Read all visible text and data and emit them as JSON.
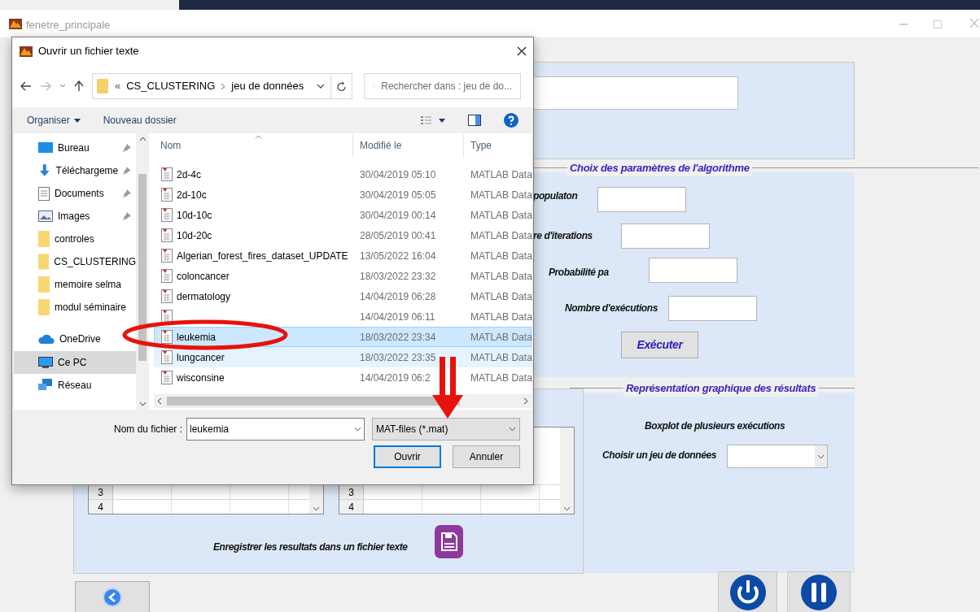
{
  "main_window": {
    "title": "fenetre_principale"
  },
  "parameters_panel": {
    "title": "Choix des paramètres de l'algorithme",
    "fields": [
      {
        "label": "populaton"
      },
      {
        "label": "re d'iterations"
      },
      {
        "label": "Probabilité pa"
      },
      {
        "label": "Nombre d'exécutions"
      }
    ],
    "run_button": "Exécuter"
  },
  "results_panel": {
    "tables": [
      {
        "rows": [
          "3",
          "4"
        ]
      },
      {
        "rows": [
          "3",
          "4"
        ]
      }
    ],
    "save_label": "Enregistrer les resultats dans un fichier texte"
  },
  "graph_panel": {
    "title": "Représentation graphique des résultats",
    "subtitle": "Boxplot de plusieurs exécutions",
    "dataset_label": "Choisir un jeu de données"
  },
  "dialog": {
    "title": "Ouvrir un fichier texte",
    "breadcrumb": [
      "CS_CLUSTERING",
      "jeu de données"
    ],
    "breadcrumb_prefix": "«",
    "search_placeholder": "Rechercher dans : jeu de do...",
    "toolbar": [
      "Organiser",
      "Nouveau dossier"
    ],
    "sidebar": [
      {
        "label": "Bureau",
        "kind": "desktop",
        "pinned": true,
        "selected": false
      },
      {
        "label": "Téléchargeme",
        "kind": "download",
        "pinned": true,
        "selected": false
      },
      {
        "label": "Documents",
        "kind": "document",
        "pinned": true,
        "selected": false
      },
      {
        "label": "Images",
        "kind": "image",
        "pinned": true,
        "selected": false
      },
      {
        "label": "controles",
        "kind": "folder",
        "pinned": false,
        "selected": false
      },
      {
        "label": "CS_CLUSTERING",
        "kind": "folder",
        "pinned": false,
        "selected": false
      },
      {
        "label": "memoire selma",
        "kind": "folder",
        "pinned": false,
        "selected": false
      },
      {
        "label": "modul séminaire",
        "kind": "folder",
        "pinned": false,
        "selected": false
      },
      {
        "label": "OneDrive",
        "kind": "cloud",
        "pinned": false,
        "selected": false
      },
      {
        "label": "Ce PC",
        "kind": "pc",
        "pinned": false,
        "selected": true
      },
      {
        "label": "Réseau",
        "kind": "network",
        "pinned": false,
        "selected": false
      }
    ],
    "columns": [
      "Nom",
      "Modifié le",
      "Type"
    ],
    "files": [
      {
        "name": "2d-4c",
        "modified": "30/04/2019 05:10",
        "type": "MATLAB Data",
        "selected": false,
        "hovered": false
      },
      {
        "name": "2d-10c",
        "modified": "30/04/2019 05:05",
        "type": "MATLAB Data",
        "selected": false,
        "hovered": false
      },
      {
        "name": "10d-10c",
        "modified": "30/04/2019 00:14",
        "type": "MATLAB Data",
        "selected": false,
        "hovered": false
      },
      {
        "name": "10d-20c",
        "modified": "28/05/2019 00:41",
        "type": "MATLAB Data",
        "selected": false,
        "hovered": false
      },
      {
        "name": "Algerian_forest_fires_dataset_UPDATE",
        "modified": "13/05/2022 16:04",
        "type": "MATLAB Data",
        "selected": false,
        "hovered": false
      },
      {
        "name": "coloncancer",
        "modified": "18/03/2022 23:32",
        "type": "MATLAB Data",
        "selected": false,
        "hovered": false
      },
      {
        "name": "dermatology",
        "modified": "14/04/2019 06:28",
        "type": "MATLAB Data",
        "selected": false,
        "hovered": false
      },
      {
        "modified": "14/04/2019 06:11",
        "type": "MATLAB Data",
        "selected": false,
        "hovered": false
      },
      {
        "name": "leukemia",
        "modified": "18/03/2022 23:34",
        "type": "MATLAB Data",
        "selected": true,
        "hovered": false
      },
      {
        "name": "lungcancer",
        "modified": "18/03/2022 23:35",
        "type": "MATLAB Data",
        "selected": false,
        "hovered": true
      },
      {
        "name": "wisconsine",
        "modified": "14/04/2019 06:2",
        "type": "MATLAB Data",
        "selected": false,
        "hovered": false
      }
    ],
    "filename_label": "Nom du fichier :",
    "filename": "leukemia",
    "filter": "MAT-files (*.mat)",
    "buttons": [
      "Ouvrir",
      "Annuler"
    ]
  }
}
